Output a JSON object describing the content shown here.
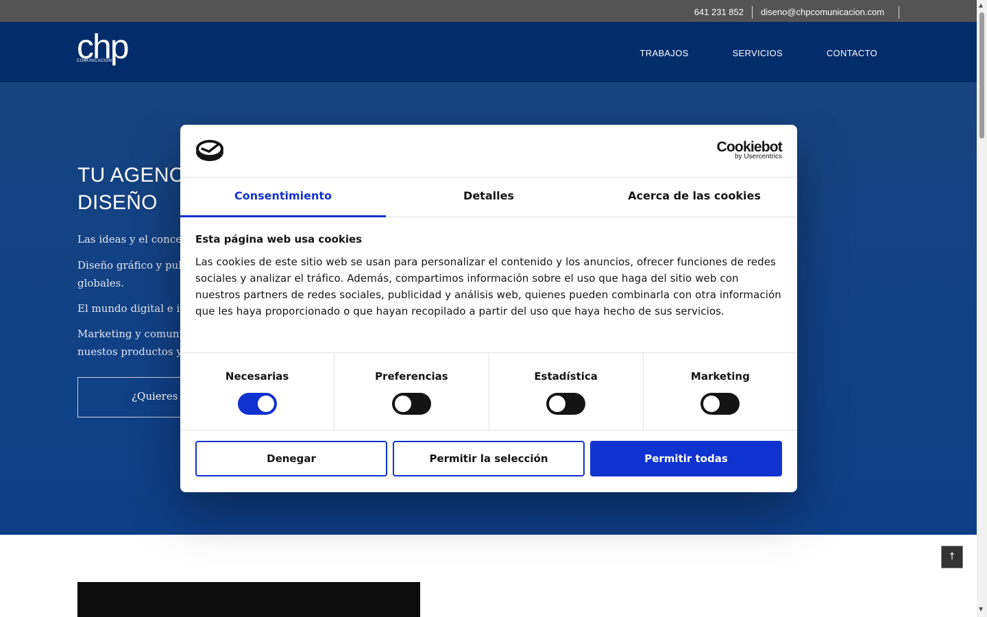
{
  "topbar": {
    "phone": "641 231 852",
    "email": "diseno@chpcomunicacion.com"
  },
  "header": {
    "logo_word": "chp",
    "logo_sub": "COMUNICACIÓN",
    "nav": [
      "TRABAJOS",
      "SERVICIOS",
      "CONTACTO"
    ]
  },
  "hero": {
    "title_line1": "TU AGENC",
    "title_line2": "DISEÑO",
    "p1": "Las ideas y el concep",
    "p2": "Diseño gráfico y pub",
    "p2b": "globales.",
    "p3": "El mundo digital e in",
    "p4": "Marketing y comunic",
    "p4b": "nuestos productos y",
    "cta": "¿Quieres c"
  },
  "scrolltop": "↑",
  "dialog": {
    "brand": "Cookiebot",
    "brand_sub": "by Usercentrics",
    "tabs": [
      "Consentimiento",
      "Detalles",
      "Acerca de las cookies"
    ],
    "heading": "Esta página web usa cookies",
    "body": "Las cookies de este sitio web se usan para personalizar el contenido y los anuncios, ofrecer funciones de redes sociales y analizar el tráfico. Además, compartimos información sobre el uso que haga del sitio web con nuestros partners de redes sociales, publicidad y análisis web, quienes pueden combinarla con otra información que les haya proporcionado o que hayan recopilado a partir del uso que haya hecho de sus servicios.",
    "toggles": [
      {
        "label": "Necesarias",
        "on": true
      },
      {
        "label": "Preferencias",
        "on": false
      },
      {
        "label": "Estadística",
        "on": false
      },
      {
        "label": "Marketing",
        "on": false
      }
    ],
    "buttons": {
      "deny": "Denegar",
      "allow_selection": "Permitir la selección",
      "allow_all": "Permitir todas"
    }
  },
  "colors": {
    "accent": "#1032cf",
    "header_bg": "#032c6b",
    "hero_bg": "#114085"
  }
}
